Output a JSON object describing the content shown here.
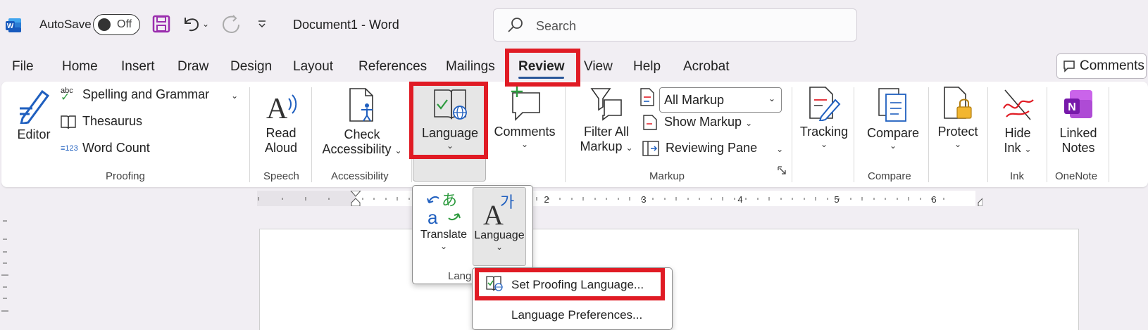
{
  "titlebar": {
    "app_icon": "word-logo-icon",
    "autosave_label": "AutoSave",
    "autosave_state": "Off",
    "document_title": "Document1  -  Word",
    "search_placeholder": "Search"
  },
  "menu_tabs": [
    "File",
    "Home",
    "Insert",
    "Draw",
    "Design",
    "Layout",
    "References",
    "Mailings",
    "Review",
    "View",
    "Help",
    "Acrobat"
  ],
  "active_tab": "Review",
  "comments_button": "Comments",
  "ribbon": {
    "proofing": {
      "editor": "Editor",
      "spelling": "Spelling and Grammar",
      "thesaurus": "Thesaurus",
      "word_count": "Word Count",
      "label": "Proofing",
      "abc_mark": "abc",
      "count_mark": "123"
    },
    "speech": {
      "read_aloud_1": "Read",
      "read_aloud_2": "Aloud",
      "label": "Speech"
    },
    "accessibility": {
      "check_1": "Check",
      "check_2": "Accessibility",
      "label": "Accessibility"
    },
    "language": {
      "label": "Language"
    },
    "comments": {
      "label": "Comments"
    },
    "markup": {
      "filter_1": "Filter All",
      "filter_2": "Markup",
      "select_value": "All Markup",
      "show_markup": "Show Markup",
      "reviewing_pane": "Reviewing Pane",
      "label": "Markup"
    },
    "tracking": {
      "label": "Tracking"
    },
    "compare": {
      "button": "Compare",
      "label": "Compare"
    },
    "protect": {
      "label": "Protect"
    },
    "ink": {
      "hide_1": "Hide",
      "hide_2": "Ink",
      "label": "Ink"
    },
    "onenote": {
      "linked_1": "Linked",
      "linked_2": "Notes",
      "label": "OneNote",
      "n_mark": "N"
    }
  },
  "ruler_numbers": [
    "2",
    "3",
    "4",
    "5",
    "6"
  ],
  "language_flyout": {
    "translate": "Translate",
    "language": "Language",
    "group_label_partial": "Lang",
    "translate_glyph_a": "a",
    "translate_glyph_kana": "あ",
    "language_glyph": "A",
    "language_glyph_hangul": "가"
  },
  "submenu": {
    "set_proofing": "Set Proofing Language...",
    "preferences": "Language Preferences..."
  },
  "colors": {
    "accent": "#2b579a",
    "highlight": "#e01b24",
    "onenote": "#7719aa"
  }
}
